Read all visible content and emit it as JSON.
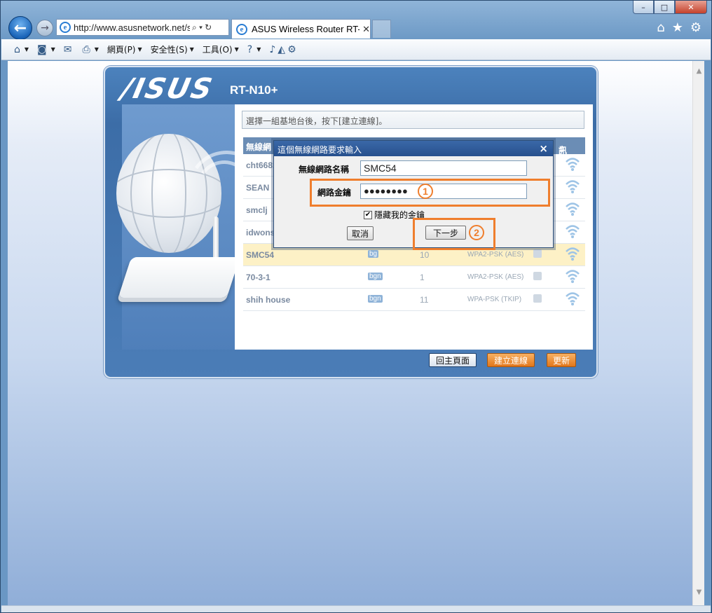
{
  "window": {
    "controls": [
      "–",
      "□",
      "✕"
    ]
  },
  "browser": {
    "back_glyph": "←",
    "forward_glyph": "→",
    "address": "http://www.asusnetwork.net/s",
    "address_tools": [
      "⌕ ▾",
      "↻"
    ],
    "tab_title": "ASUS Wireless Router RT-...",
    "tab_close": "✕",
    "right_icons": [
      "⌂",
      "★",
      "⚙"
    ],
    "command_bar": [
      {
        "icon": "home-icon",
        "glyph": "⌂",
        "label": "",
        "dropdown": true
      },
      {
        "icon": "rss-icon",
        "glyph": "◙",
        "label": "",
        "dropdown": true
      },
      {
        "icon": "mail-icon",
        "glyph": "✉",
        "label": "",
        "dropdown": false
      },
      {
        "icon": "print-icon",
        "glyph": "⎙",
        "label": "",
        "dropdown": true
      },
      {
        "icon": "",
        "glyph": "",
        "label": "網頁(P)",
        "dropdown": true
      },
      {
        "icon": "",
        "glyph": "",
        "label": "安全性(S)",
        "dropdown": true
      },
      {
        "icon": "",
        "glyph": "",
        "label": "工具(O)",
        "dropdown": true
      },
      {
        "icon": "help-icon",
        "glyph": "?",
        "label": "",
        "dropdown": true
      }
    ]
  },
  "page": {
    "brand": "/ISUS",
    "model": "RT-N10+",
    "instruction": "選擇一組基地台後，按下[建立連線]。",
    "table": {
      "col_ssid": "無線網",
      "col_signal": "訊號",
      "sort_glyph": "⇕",
      "rows": [
        {
          "ssid": "cht6681",
          "mode": "",
          "channel": "",
          "auth": "",
          "locked": false,
          "selected": false
        },
        {
          "ssid": "SEAN",
          "mode": "",
          "channel": "",
          "auth": "",
          "locked": false,
          "selected": false
        },
        {
          "ssid": "smclj",
          "mode": "",
          "channel": "",
          "auth": "",
          "locked": false,
          "selected": false
        },
        {
          "ssid": "idwons",
          "mode": "",
          "channel": "",
          "auth": "",
          "locked": false,
          "selected": false
        },
        {
          "ssid": "SMC54",
          "mode": "bg",
          "channel": "10",
          "auth": "WPA2-PSK (AES)",
          "locked": true,
          "selected": true
        },
        {
          "ssid": "70-3-1",
          "mode": "bgn",
          "channel": "1",
          "auth": "WPA2-PSK (AES)",
          "locked": true,
          "selected": false
        },
        {
          "ssid": "shih house",
          "mode": "bgn",
          "channel": "11",
          "auth": "WPA-PSK (TKIP)",
          "locked": true,
          "selected": false
        }
      ]
    },
    "dialog": {
      "title": "這個無線網路要求輸入",
      "close": "×",
      "network_name_label": "無線網路名稱",
      "network_name_value": "SMC54",
      "key_label": "網路金鑰",
      "key_value": "●●●●●●●●",
      "hide_key_label": "隱藏我的金鑰",
      "hide_key_checked": "✔",
      "cancel_label": "取消",
      "next_label": "下一步",
      "step1": "1",
      "step2": "2"
    },
    "buttons": {
      "home": "回主頁面",
      "connect": "建立連線",
      "refresh": "更新"
    }
  },
  "colors": {
    "highlight": "#ef7e2d",
    "selected_row": "#fdf1c6",
    "panel_blue": "#3c6da7"
  }
}
